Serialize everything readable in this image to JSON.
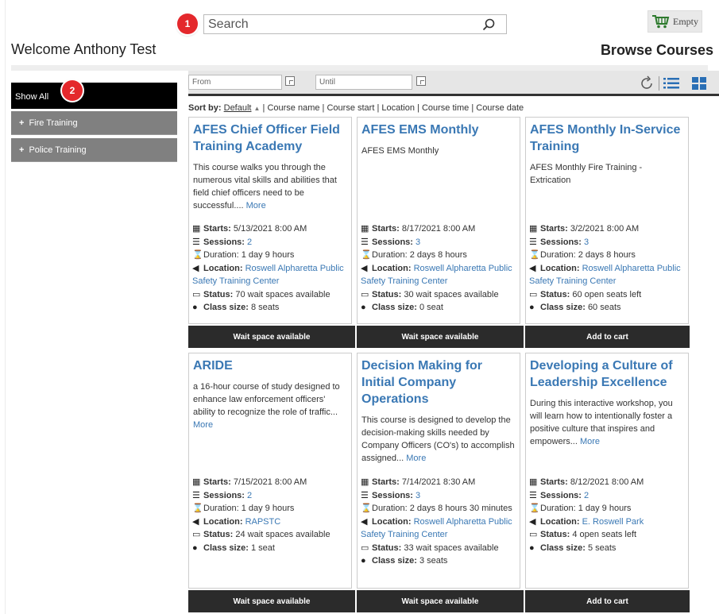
{
  "header": {
    "search_placeholder": "Search",
    "cart_label": "Empty",
    "welcome": "Welcome Anthony Test",
    "browse_title": "Browse Courses"
  },
  "badges": [
    "1",
    "2"
  ],
  "sidebar": {
    "show_all": "Show All",
    "categories": [
      {
        "label": "Fire Training",
        "icon": "+"
      },
      {
        "label": "Police Training",
        "icon": "+"
      }
    ]
  },
  "filters": {
    "from_placeholder": "From",
    "until_placeholder": "Until"
  },
  "sort": {
    "label": "Sort by:",
    "default": "Default",
    "default_arrow": "▲",
    "options": [
      "Course name",
      "Course start",
      "Location",
      "Course time",
      "Course date"
    ]
  },
  "field_labels": {
    "starts": "Starts:",
    "sessions": "Sessions:",
    "duration": "Duration:",
    "location": "Location:",
    "status": "Status:",
    "class_size": "Class size:"
  },
  "more_label": "More",
  "courses": [
    {
      "title": "AFES Chief Officer Field Training Academy",
      "description": "This course walks you through the numerous vital skills and abilities that field chief officers need to be successful....",
      "has_more": true,
      "starts": "5/13/2021 8:00 AM",
      "sessions": "2",
      "duration": "1 day 9 hours",
      "location": "Roswell Alpharetta Public Safety Training Center",
      "status": "70 wait spaces available",
      "class_size": "8 seats",
      "button": "Wait space available"
    },
    {
      "title": "AFES EMS Monthly",
      "description": "AFES EMS Monthly",
      "has_more": false,
      "starts": "8/17/2021 8:00 AM",
      "sessions": "3",
      "duration": "2 days 8 hours",
      "location": "Roswell Alpharetta Public Safety Training Center",
      "status": "30 wait spaces available",
      "class_size": "0 seat",
      "button": "Wait space available"
    },
    {
      "title": "AFES Monthly In-Service Training",
      "description": "AFES Monthly Fire Training - Extrication",
      "has_more": false,
      "starts": "3/2/2021 8:00 AM",
      "sessions": "3",
      "duration": "2 days 8 hours",
      "location": "Roswell Alpharetta Public Safety Training Center",
      "status": "60 open seats left",
      "class_size": "60 seats",
      "button": "Add to cart"
    },
    {
      "title": "ARIDE",
      "description": "a 16-hour course of study designed to enhance law enforcement officers' ability to recognize the role of traffic...",
      "has_more": true,
      "starts": "7/15/2021 8:00 AM",
      "sessions": "2",
      "duration": "1 day 9 hours",
      "location": "RAPSTC",
      "status": "24 wait spaces available",
      "class_size": "1 seat",
      "button": "Wait space available"
    },
    {
      "title": "Decision Making for Initial Company Operations",
      "description": "This course is designed to develop the decision-making skills needed by Company Officers (CO's) to accomplish assigned...",
      "has_more": true,
      "starts": "7/14/2021 8:30 AM",
      "sessions": "3",
      "duration": "2 days 8 hours 30 minutes",
      "location": "Roswell Alpharetta Public Safety Training Center",
      "status": "33 wait spaces available",
      "class_size": "3 seats",
      "button": "Wait space available"
    },
    {
      "title": "Developing a Culture of Leadership Excellence",
      "description": "During this interactive workshop, you will learn how to intentionally foster a positive culture that inspires and empowers...",
      "has_more": true,
      "starts": "8/12/2021 8:00 AM",
      "sessions": "2",
      "duration": "1 day 9 hours",
      "location": "E. Roswell Park",
      "status": "4 open seats left",
      "class_size": "5 seats",
      "button": "Add to cart"
    }
  ]
}
